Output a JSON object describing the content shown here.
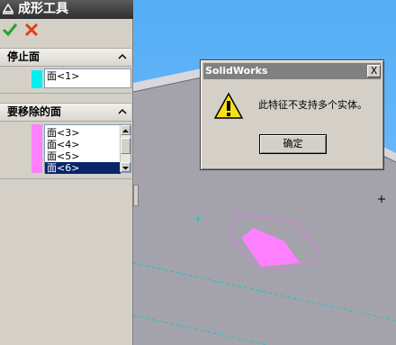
{
  "panel": {
    "title": "成形工具",
    "ok_icon": "check-icon",
    "cancel_icon": "x-icon",
    "stop_face": {
      "header": "停止面",
      "swatch_color": "#00f0f0",
      "items": [
        "面<1>"
      ]
    },
    "remove_faces": {
      "header": "要移除的面",
      "swatch_color": "#ff80ff",
      "items": [
        "面<3>",
        "面<4>",
        "面<5>",
        "面<6>"
      ],
      "selected_index": 3
    }
  },
  "dialog": {
    "title": "SolidWorks",
    "close_label": "X",
    "icon": "warning-icon",
    "message": "此特征不支持多个实体。",
    "ok_label": "确定"
  },
  "colors": {
    "titlebar": "#3c3c3c",
    "viewport_bg": "#5ab0f8",
    "plate": "#a3a2aa",
    "highlight_face": "#ff80ff",
    "cyan_lines": "#00d0d0"
  }
}
